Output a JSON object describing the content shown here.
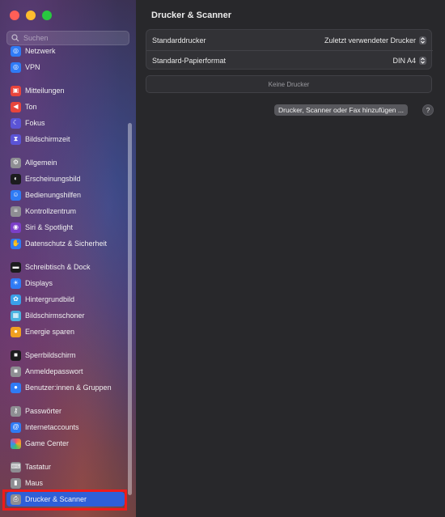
{
  "window": {
    "title": "Drucker & Scanner"
  },
  "search": {
    "placeholder": "Suchen"
  },
  "sidebar": {
    "items": [
      {
        "label": "Netzwerk",
        "icon": "globe-icon",
        "color": "#2f7bf5"
      },
      {
        "label": "VPN",
        "icon": "globe-icon",
        "color": "#2f7bf5"
      },
      {
        "label": "Mitteilungen",
        "icon": "bell-icon",
        "color": "#e8453c"
      },
      {
        "label": "Ton",
        "icon": "speaker-icon",
        "color": "#e8453c"
      },
      {
        "label": "Fokus",
        "icon": "moon-icon",
        "color": "#5b54d6"
      },
      {
        "label": "Bildschirmzeit",
        "icon": "hourglass-icon",
        "color": "#5b54d6"
      },
      {
        "label": "Allgemein",
        "icon": "gear-icon",
        "color": "#8e8e93"
      },
      {
        "label": "Erscheinungsbild",
        "icon": "appearance-icon",
        "color": "#1c1c1e"
      },
      {
        "label": "Bedienungshilfen",
        "icon": "accessibility-icon",
        "color": "#2f7bf5"
      },
      {
        "label": "Kontrollzentrum",
        "icon": "switches-icon",
        "color": "#8e8e93"
      },
      {
        "label": "Siri & Spotlight",
        "icon": "siri-icon",
        "color": "#7b3fc8"
      },
      {
        "label": "Datenschutz & Sicherheit",
        "icon": "hand-icon",
        "color": "#2f7bf5"
      },
      {
        "label": "Schreibtisch & Dock",
        "icon": "dock-icon",
        "color": "#1c1c1e"
      },
      {
        "label": "Displays",
        "icon": "sun-icon",
        "color": "#2f7bf5"
      },
      {
        "label": "Hintergrundbild",
        "icon": "flower-icon",
        "color": "#3aa0e8"
      },
      {
        "label": "Bildschirmschoner",
        "icon": "screensaver-icon",
        "color": "#4bb3e0"
      },
      {
        "label": "Energie sparen",
        "icon": "bulb-icon",
        "color": "#f0a020"
      },
      {
        "label": "Sperrbildschirm",
        "icon": "lock-icon",
        "color": "#1c1c1e"
      },
      {
        "label": "Anmeldepasswort",
        "icon": "lock-icon",
        "color": "#8e8e93"
      },
      {
        "label": "Benutzer:innen & Gruppen",
        "icon": "users-icon",
        "color": "#2f7bf5"
      },
      {
        "label": "Passwörter",
        "icon": "key-icon",
        "color": "#8e8e93"
      },
      {
        "label": "Internetaccounts",
        "icon": "at-icon",
        "color": "#2f7bf5"
      },
      {
        "label": "Game Center",
        "icon": "game-center-icon",
        "color": "#ffffff"
      },
      {
        "label": "Tastatur",
        "icon": "keyboard-icon",
        "color": "#8e8e93"
      },
      {
        "label": "Maus",
        "icon": "mouse-icon",
        "color": "#8e8e93"
      },
      {
        "label": "Drucker & Scanner",
        "icon": "printer-icon",
        "color": "#8e8e93",
        "selected": true
      }
    ]
  },
  "main": {
    "title": "Drucker & Scanner",
    "default_printer_label": "Standarddrucker",
    "default_printer_value": "Zuletzt verwendeter Drucker",
    "paper_size_label": "Standard-Papierformat",
    "paper_size_value": "DIN A4",
    "empty_label": "Keine Drucker",
    "add_button": "Drucker, Scanner oder Fax hinzufügen ...",
    "help_label": "?"
  },
  "colors": {
    "accent": "#2f5fd7",
    "annotation": "#ee1b1b"
  }
}
